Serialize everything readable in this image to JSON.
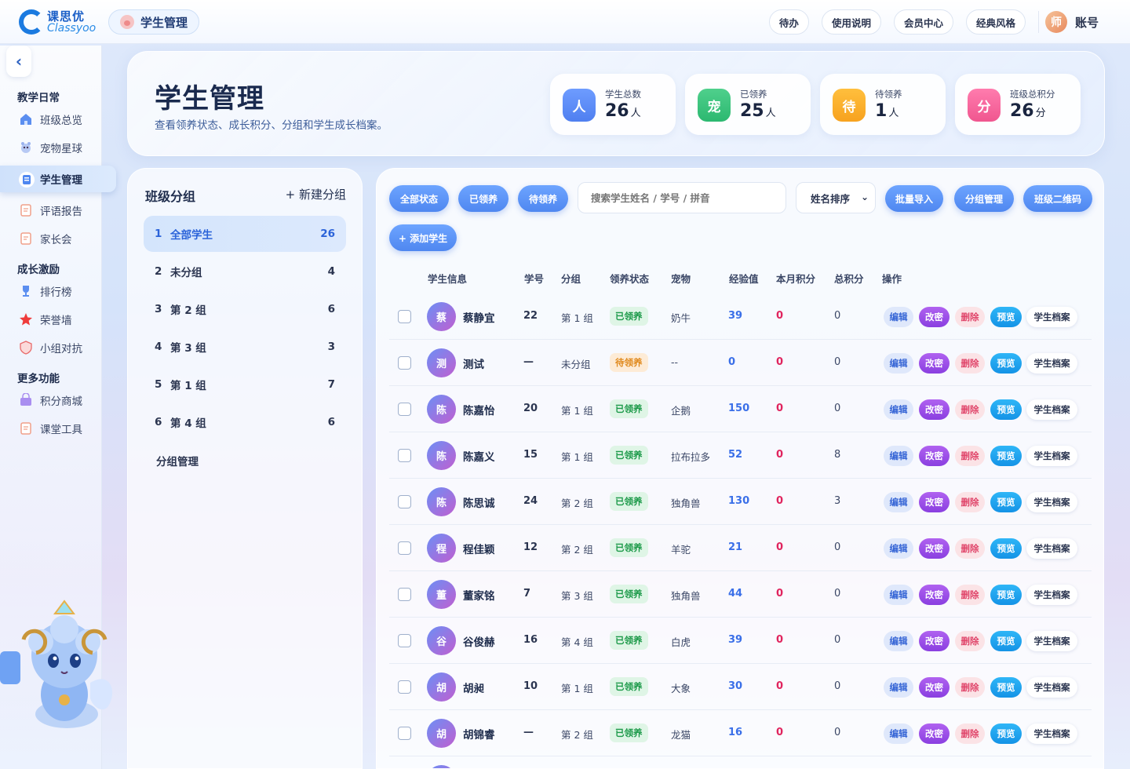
{
  "brand": {
    "cn": "课思优",
    "en": "Classyoo"
  },
  "header_pill": "学生管理",
  "topnav": [
    "待办",
    "使用说明",
    "会员中心",
    "经典风格"
  ],
  "account": {
    "avatar": "师",
    "label": "账号"
  },
  "sidebar": {
    "sections": [
      {
        "title": "教学日常",
        "items": [
          {
            "label": "班级总览",
            "icon": "home-icon"
          },
          {
            "label": "宠物星球",
            "icon": "pet-planet-icon"
          },
          {
            "label": "学生管理",
            "icon": "student-icon",
            "active": true
          },
          {
            "label": "评语报告",
            "icon": "report-icon"
          },
          {
            "label": "家长会",
            "icon": "parent-meeting-icon"
          }
        ]
      },
      {
        "title": "成长激励",
        "items": [
          {
            "label": "排行榜",
            "icon": "trophy-icon"
          },
          {
            "label": "荣誉墙",
            "icon": "star-icon"
          },
          {
            "label": "小组对抗",
            "icon": "shield-icon"
          }
        ]
      },
      {
        "title": "更多功能",
        "items": [
          {
            "label": "积分商城",
            "icon": "shop-icon"
          },
          {
            "label": "课堂工具",
            "icon": "tool-icon"
          }
        ]
      }
    ]
  },
  "page": {
    "title": "学生管理",
    "subtitle": "查看领养状态、成长积分、分组和学生成长档案。"
  },
  "stats": [
    {
      "icon": "人",
      "label": "学生总数",
      "value": "26",
      "unit": "人",
      "color": "#4f7ff0"
    },
    {
      "icon": "宠",
      "label": "已领养",
      "value": "25",
      "unit": "人",
      "color": "#2cb870"
    },
    {
      "icon": "待",
      "label": "待领养",
      "value": "1",
      "unit": "人",
      "color": "#f7a21f"
    },
    {
      "icon": "分",
      "label": "班级总积分",
      "value": "26",
      "unit": "分",
      "color": "#f0568f"
    }
  ],
  "groups": {
    "title": "班级分组",
    "new_label": "+ 新建分组",
    "items": [
      {
        "no": "1",
        "label": "全部学生",
        "count": "26"
      },
      {
        "no": "2",
        "label": "未分组",
        "count": "4"
      },
      {
        "no": "3",
        "label": "第 2 组",
        "count": "6"
      },
      {
        "no": "4",
        "label": "第 3 组",
        "count": "3"
      },
      {
        "no": "5",
        "label": "第 1 组",
        "count": "7"
      },
      {
        "no": "6",
        "label": "第 4 组",
        "count": "6"
      }
    ],
    "manage_label": "分组管理"
  },
  "toolbar": {
    "filters": [
      "全部状态",
      "已领养",
      "待领养"
    ],
    "search_placeholder": "搜索学生姓名 / 学号 / 拼音",
    "sort_value": "姓名排序",
    "actions": [
      "批量导入",
      "分组管理",
      "班级二维码"
    ],
    "add_label": "+ 添加学生"
  },
  "table": {
    "columns": [
      "学生信息",
      "学号",
      "分组",
      "领养状态",
      "宠物",
      "经验值",
      "本月积分",
      "总积分",
      "操作"
    ],
    "row_actions": [
      "编辑",
      "改密",
      "删除",
      "预览",
      "学生档案"
    ],
    "rows": [
      {
        "avatar": "蔡",
        "name": "蔡静宜",
        "id": "22",
        "group": "第 1 组",
        "status": "已领养",
        "adopted": true,
        "pet": "奶牛",
        "xp": "39",
        "month": "0",
        "total": "0"
      },
      {
        "avatar": "测",
        "name": "测试",
        "id": "—",
        "group": "未分组",
        "status": "待领养",
        "adopted": false,
        "pet": "--",
        "xp": "0",
        "month": "0",
        "total": "0"
      },
      {
        "avatar": "陈",
        "name": "陈嘉怡",
        "id": "20",
        "group": "第 1 组",
        "status": "已领养",
        "adopted": true,
        "pet": "企鹅",
        "xp": "150",
        "month": "0",
        "total": "0"
      },
      {
        "avatar": "陈",
        "name": "陈嘉义",
        "id": "15",
        "group": "第 1 组",
        "status": "已领养",
        "adopted": true,
        "pet": "拉布拉多",
        "xp": "52",
        "month": "0",
        "total": "8"
      },
      {
        "avatar": "陈",
        "name": "陈思诚",
        "id": "24",
        "group": "第 2 组",
        "status": "已领养",
        "adopted": true,
        "pet": "独角兽",
        "xp": "130",
        "month": "0",
        "total": "3"
      },
      {
        "avatar": "程",
        "name": "程佳颖",
        "id": "12",
        "group": "第 2 组",
        "status": "已领养",
        "adopted": true,
        "pet": "羊驼",
        "xp": "21",
        "month": "0",
        "total": "0"
      },
      {
        "avatar": "董",
        "name": "董家铭",
        "id": "7",
        "group": "第 3 组",
        "status": "已领养",
        "adopted": true,
        "pet": "独角兽",
        "xp": "44",
        "month": "0",
        "total": "0"
      },
      {
        "avatar": "谷",
        "name": "谷俊赫",
        "id": "16",
        "group": "第 4 组",
        "status": "已领养",
        "adopted": true,
        "pet": "白虎",
        "xp": "39",
        "month": "0",
        "total": "0"
      },
      {
        "avatar": "胡",
        "name": "胡昶",
        "id": "10",
        "group": "第 1 组",
        "status": "已领养",
        "adopted": true,
        "pet": "大象",
        "xp": "30",
        "month": "0",
        "total": "0"
      },
      {
        "avatar": "胡",
        "name": "胡锦睿",
        "id": "—",
        "group": "第 2 组",
        "status": "已领养",
        "adopted": true,
        "pet": "龙猫",
        "xp": "16",
        "month": "0",
        "total": "0"
      }
    ]
  }
}
